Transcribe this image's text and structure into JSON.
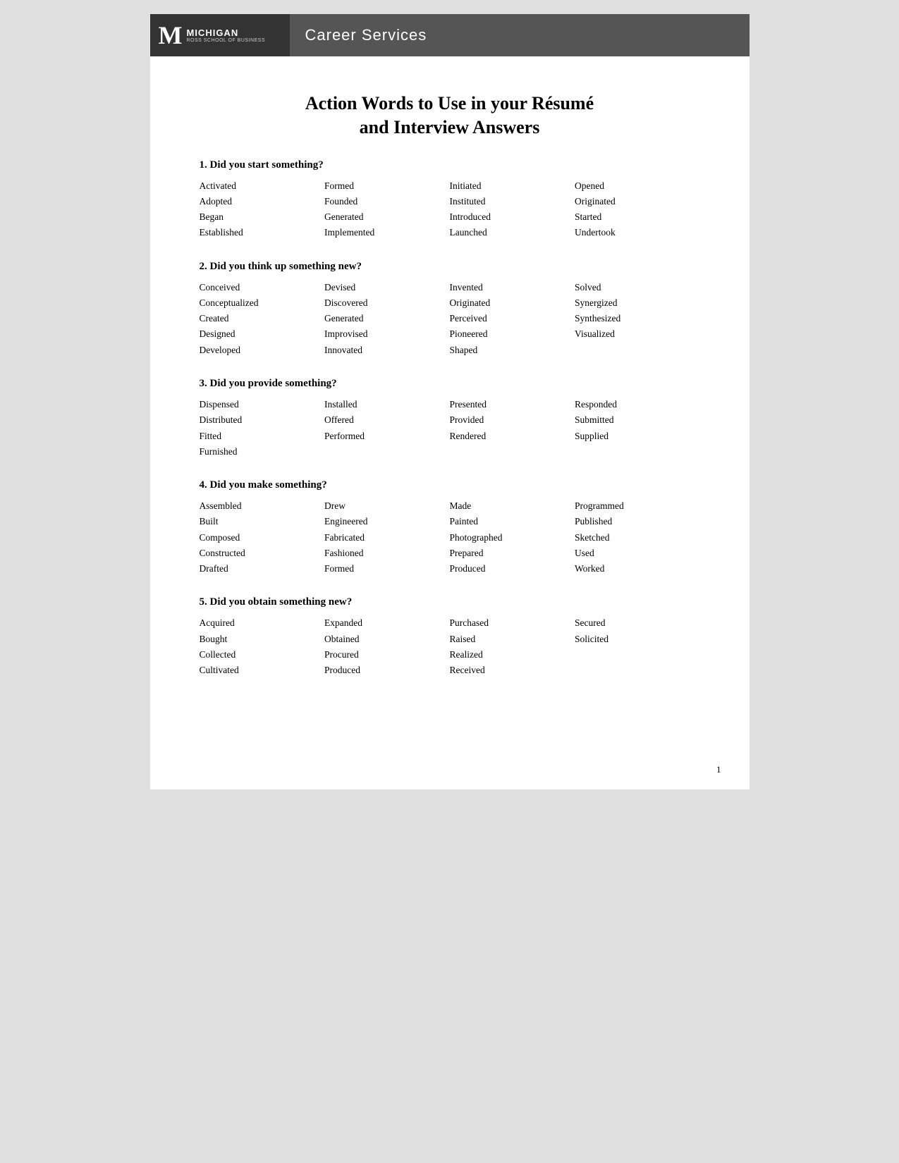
{
  "header": {
    "logo_m": "M",
    "logo_michigan": "MICHIGAN",
    "logo_ross": "ROSS SCHOOL OF BUSINESS",
    "career_services": "Career Services"
  },
  "title_line1": "Action Words to Use in your Résumé",
  "title_line2": "and Interview Answers",
  "sections": [
    {
      "id": "section1",
      "heading": "1. Did you start something?",
      "columns": [
        [
          "Activated",
          "Adopted",
          "Began",
          "Established"
        ],
        [
          "Formed",
          "Founded",
          "Generated",
          "Implemented"
        ],
        [
          "Initiated",
          "Instituted",
          "Introduced",
          "Launched"
        ],
        [
          "Opened",
          "Originated",
          "Started",
          "Undertook"
        ]
      ]
    },
    {
      "id": "section2",
      "heading": "2. Did you think up something new?",
      "columns": [
        [
          "Conceived",
          "Conceptualized",
          "Created",
          "Designed",
          "Developed"
        ],
        [
          "Devised",
          "Discovered",
          "Generated",
          "Improvised",
          "Innovated"
        ],
        [
          "Invented",
          "Originated",
          "Perceived",
          "Pioneered",
          "Shaped"
        ],
        [
          "Solved",
          "Synergized",
          "Synthesized",
          "Visualized"
        ]
      ]
    },
    {
      "id": "section3",
      "heading": "3. Did you provide something?",
      "columns": [
        [
          "Dispensed",
          "Distributed",
          "Fitted",
          "Furnished"
        ],
        [
          "Installed",
          "Offered",
          "Performed"
        ],
        [
          "Presented",
          "Provided",
          "Rendered"
        ],
        [
          "Responded",
          "Submitted",
          "Supplied"
        ]
      ]
    },
    {
      "id": "section4",
      "heading": "4. Did you make something?",
      "columns": [
        [
          "Assembled",
          "Built",
          "Composed",
          "Constructed",
          "Drafted"
        ],
        [
          "Drew",
          "Engineered",
          "Fabricated",
          "Fashioned",
          "Formed"
        ],
        [
          "Made",
          "Painted",
          "Photographed",
          "Prepared",
          "Produced"
        ],
        [
          "Programmed",
          "Published",
          "Sketched",
          "Used",
          "Worked"
        ]
      ]
    },
    {
      "id": "section5",
      "heading": "5. Did you obtain something new?",
      "columns": [
        [
          "Acquired",
          "Bought",
          "Collected",
          "Cultivated"
        ],
        [
          "Expanded",
          "Obtained",
          "Procured",
          "Produced"
        ],
        [
          "Purchased",
          "Raised",
          "Realized",
          "Received"
        ],
        [
          "Secured",
          "Solicited"
        ]
      ]
    }
  ],
  "page_number": "1"
}
